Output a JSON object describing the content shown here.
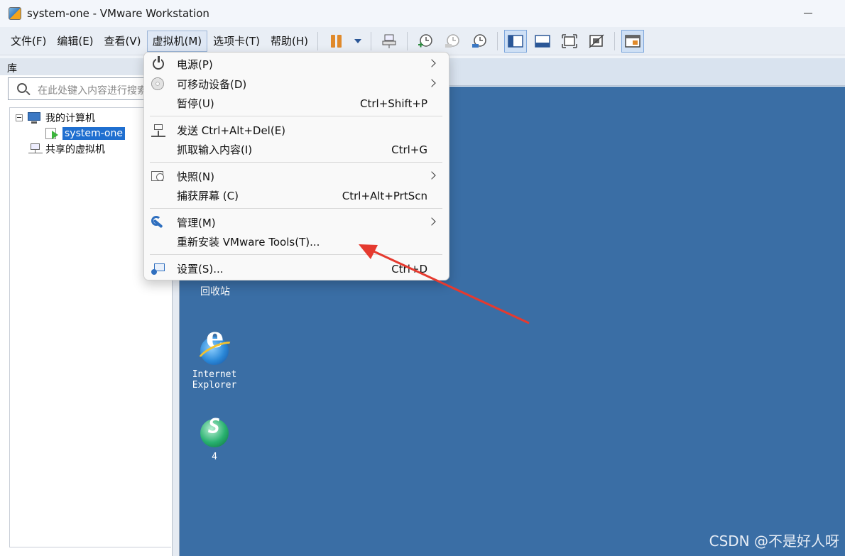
{
  "window": {
    "title": "system-one - VMware Workstation"
  },
  "menubar": {
    "items": [
      {
        "label": "文件(F)"
      },
      {
        "label": "编辑(E)"
      },
      {
        "label": "查看(V)"
      },
      {
        "label": "虚拟机(M)"
      },
      {
        "label": "选项卡(T)"
      },
      {
        "label": "帮助(H)"
      }
    ]
  },
  "library": {
    "header": "库",
    "search_placeholder": "在此处键入内容进行搜索",
    "tree": {
      "root": "我的计算机",
      "vm": "system-one",
      "shared": "共享的虚拟机"
    }
  },
  "vm_menu": {
    "items": [
      {
        "label": "电源(P)",
        "shortcut": "",
        "submenu": true,
        "icon": "power-icon"
      },
      {
        "label": "可移动设备(D)",
        "shortcut": "",
        "submenu": true,
        "icon": "disc-icon"
      },
      {
        "label": "暂停(U)",
        "shortcut": "Ctrl+Shift+P",
        "submenu": false,
        "icon": ""
      },
      {
        "label": "发送 Ctrl+Alt+Del(E)",
        "shortcut": "",
        "submenu": false,
        "icon": "network-send-icon"
      },
      {
        "label": "抓取输入内容(I)",
        "shortcut": "Ctrl+G",
        "submenu": false,
        "icon": ""
      },
      {
        "label": "快照(N)",
        "shortcut": "",
        "submenu": true,
        "icon": "snapshot-icon"
      },
      {
        "label": "捕获屏幕 (C)",
        "shortcut": "Ctrl+Alt+PrtScn",
        "submenu": false,
        "icon": ""
      },
      {
        "label": "管理(M)",
        "shortcut": "",
        "submenu": true,
        "icon": "wrench-icon"
      },
      {
        "label": "重新安装 VMware Tools(T)...",
        "shortcut": "",
        "submenu": false,
        "icon": ""
      },
      {
        "label": "设置(S)...",
        "shortcut": "Ctrl+D",
        "submenu": false,
        "icon": "settings-icon"
      }
    ]
  },
  "desktop": {
    "recycle_bin": "回收站",
    "ie_line1": "Internet",
    "ie_line2": "Explorer",
    "app4": "4"
  },
  "watermark": "CSDN @不是好人呀",
  "colors": {
    "desktop_bg": "#3a6ea5",
    "selection": "#1f6fd0",
    "annotation_arrow": "#e53a2f"
  }
}
